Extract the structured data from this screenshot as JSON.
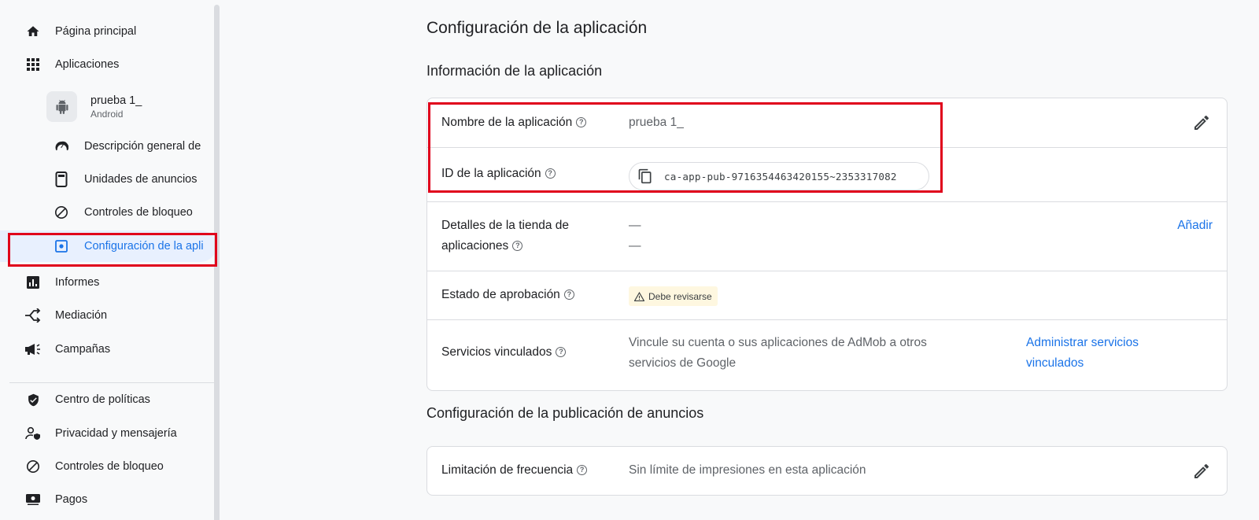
{
  "sidebar": {
    "items": [
      {
        "label": "Página principal",
        "icon": "home-icon"
      },
      {
        "label": "Aplicaciones",
        "icon": "apps-grid-icon"
      },
      {
        "label": "Informes",
        "icon": "reports-icon"
      },
      {
        "label": "Mediación",
        "icon": "mediation-icon"
      },
      {
        "label": "Campañas",
        "icon": "megaphone-icon"
      },
      {
        "label": "Centro de políticas",
        "icon": "shield-icon"
      },
      {
        "label": "Privacidad y mensajería",
        "icon": "privacy-icon"
      },
      {
        "label": "Controles de bloqueo",
        "icon": "block-icon"
      },
      {
        "label": "Pagos",
        "icon": "payments-icon"
      }
    ],
    "app": {
      "name": "prueba 1_",
      "platform": "Android",
      "icon": "android-icon"
    },
    "app_subitems": [
      {
        "label": "Descripción general de",
        "icon": "speedometer-icon"
      },
      {
        "label": "Unidades de anuncios",
        "icon": "ad-unit-icon"
      },
      {
        "label": "Controles de bloqueo",
        "icon": "block-icon"
      },
      {
        "label": "Configuración de la apli",
        "icon": "settings-icon"
      }
    ]
  },
  "main": {
    "page_title": "Configuración de la aplicación",
    "app_info": {
      "title": "Información de la aplicación",
      "name_label": "Nombre de la aplicación",
      "name_value": "prueba 1_",
      "id_label": "ID de la aplicación",
      "id_value": "ca-app-pub-9716354463420155~2353317082",
      "store_label_1": "Detalles de la tienda de",
      "store_label_2": "aplicaciones",
      "store_value_1": "—",
      "store_value_2": "—",
      "store_action": "Añadir",
      "approval_label": "Estado de aprobación",
      "approval_badge": "Debe revisarse",
      "linked_label": "Servicios vinculados",
      "linked_desc_1": "Vincule su cuenta o sus aplicaciones de AdMob a otros",
      "linked_desc_2": "servicios de Google",
      "linked_action_1": "Administrar servicios",
      "linked_action_2": "vinculados"
    },
    "ad_serving": {
      "title": "Configuración de la publicación de anuncios",
      "freq_label": "Limitación de frecuencia",
      "freq_value": "Sin límite de impresiones en esta aplicación"
    },
    "help_glyph": "?"
  },
  "colors": {
    "accent": "#1a73e8",
    "highlight": "#e0001b",
    "active_bg": "#e8f0fe",
    "badge_bg": "#fef7e0"
  }
}
